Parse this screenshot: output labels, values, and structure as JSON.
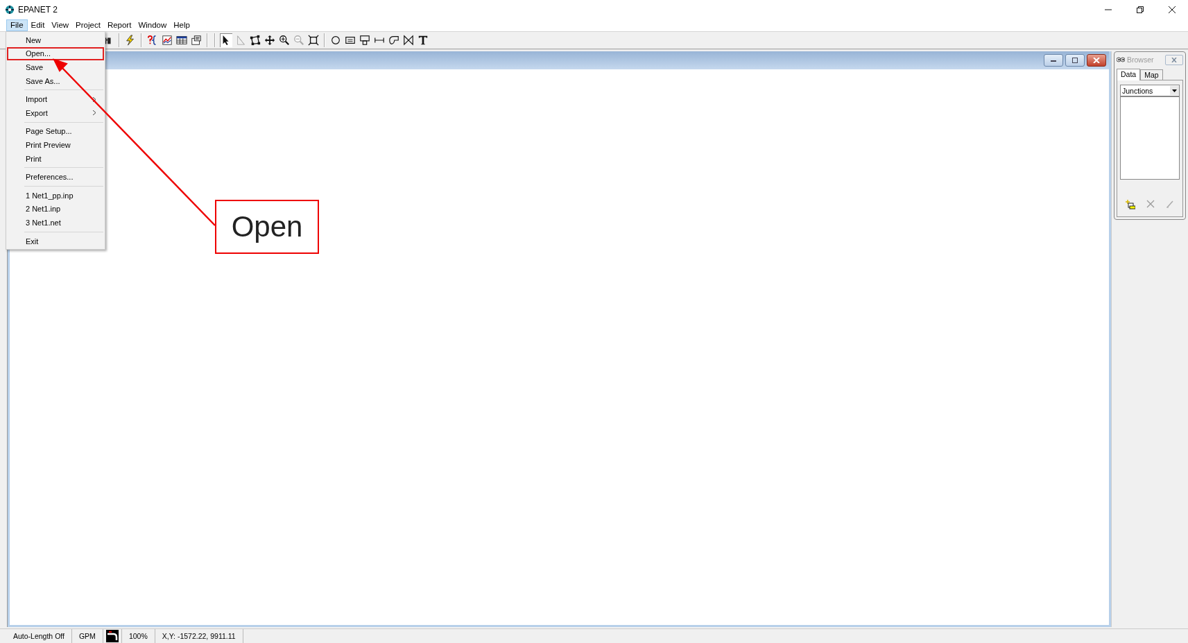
{
  "window": {
    "title": "EPANET 2"
  },
  "menu_bar": [
    {
      "label": "File",
      "selected": true
    },
    {
      "label": "Edit",
      "selected": false
    },
    {
      "label": "View",
      "selected": false
    },
    {
      "label": "Project",
      "selected": false
    },
    {
      "label": "Report",
      "selected": false
    },
    {
      "label": "Window",
      "selected": false
    },
    {
      "label": "Help",
      "selected": false
    }
  ],
  "file_menu": {
    "groups": [
      [
        {
          "label": "New",
          "highlighted": false,
          "submenu": false
        },
        {
          "label": "Open...",
          "highlighted": true,
          "submenu": false
        },
        {
          "label": "Save",
          "highlighted": false,
          "submenu": false
        },
        {
          "label": "Save As...",
          "highlighted": false,
          "submenu": false
        }
      ],
      [
        {
          "label": "Import",
          "highlighted": false,
          "submenu": true
        },
        {
          "label": "Export",
          "highlighted": false,
          "submenu": true
        }
      ],
      [
        {
          "label": "Page Setup...",
          "highlighted": false,
          "submenu": false
        },
        {
          "label": "Print Preview",
          "highlighted": false,
          "submenu": false
        },
        {
          "label": "Print",
          "highlighted": false,
          "submenu": false
        }
      ],
      [
        {
          "label": "Preferences...",
          "highlighted": false,
          "submenu": false
        }
      ],
      [
        {
          "label": "1 Net1_pp.inp",
          "highlighted": false,
          "submenu": false
        },
        {
          "label": "2 Net1.inp",
          "highlighted": false,
          "submenu": false
        },
        {
          "label": "3 Net1.net",
          "highlighted": false,
          "submenu": false
        }
      ],
      [
        {
          "label": "Exit",
          "highlighted": false,
          "submenu": false
        }
      ]
    ]
  },
  "browser": {
    "title": "Browser",
    "tabs": [
      {
        "label": "Data",
        "selected": true
      },
      {
        "label": "Map",
        "selected": false
      }
    ],
    "category": "Junctions"
  },
  "status_bar": [
    "Auto-Length Off",
    "GPM",
    "100%",
    "X,Y: -1572.22, 9911.11"
  ],
  "annotation": {
    "label": "Open"
  }
}
